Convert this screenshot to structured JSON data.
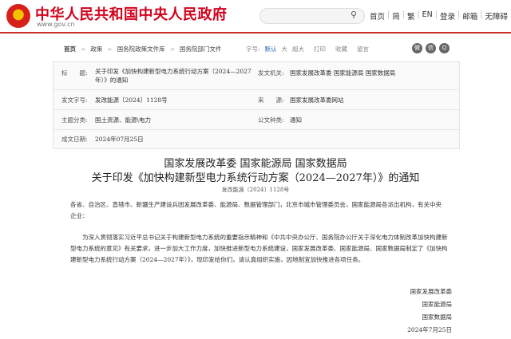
{
  "header": {
    "site_title": "中华人民共和国中央人民政府",
    "site_url": "www.gov.cn",
    "search_placeholder": "",
    "search_icon": "search-icon",
    "nav": [
      "首页",
      "简",
      "繁",
      "EN",
      "登录",
      "邮箱",
      "无障碍"
    ]
  },
  "breadcrumb": [
    "首页",
    "政策",
    "国务院政策文件库",
    "国务院部门文件"
  ],
  "toolbar": {
    "font_label": "字号:",
    "font_sizes": [
      "默认",
      "大",
      "超大"
    ],
    "print": "打印",
    "favorite": "收藏",
    "comment": "留言",
    "share_icons": [
      "weibo-icon",
      "wechat-icon",
      "qq-icon"
    ]
  },
  "meta": {
    "title_key": "标　　题:",
    "title_value": "关于印发《加快构建新型电力系统行动方案（2024—2027年）》的通知",
    "issuer_key": "发文机关:",
    "issuer_value": "国家发展改革委 国家能源局 国家数据局",
    "docno_key": "发文字号:",
    "docno_value": "发改能源〔2024〕1128号",
    "source_key": "来　　源:",
    "source_value": "国家发展改革委网站",
    "topic_key": "主题分类:",
    "topic_value": "国土资源、能源\\电力",
    "type_key": "公文种类:",
    "type_value": "通知",
    "date_key": "成文日期:",
    "date_value": "2024年07月25日"
  },
  "article": {
    "issuers_heading": "国家发展改革委 国家能源局 国家数据局",
    "title": "关于印发《加快构建新型电力系统行动方案（2024—2027年）》的通知",
    "docno": "发改能源〔2024〕1128号",
    "recipients": "各省、自治区、直辖市、新疆生产建设兵团发展改革委、能源局、数据管理部门，北京市城市管理委员会，国家能源局各派出机构，有关中央企业：",
    "body": "为深入贯彻落实习近平总书记关于构建新型电力系统的重要指示精神和《中共中央办公厅、国务院办公厅关于深化电力体制改革加快构建新型电力系统的意见》有关要求，进一步加大工作力度，加快推进新型电力系统建设，国家发展改革委、国家能源局、国家数据局制定了《加快构建新型电力系统行动方案（2024—2027年）》，现印发给你们，请认真组织实施，因地制宜加快推进各项任务。",
    "signatures": [
      "国家发展改革委",
      "国家能源局",
      "国家数据局",
      "2024年7月25日"
    ]
  }
}
